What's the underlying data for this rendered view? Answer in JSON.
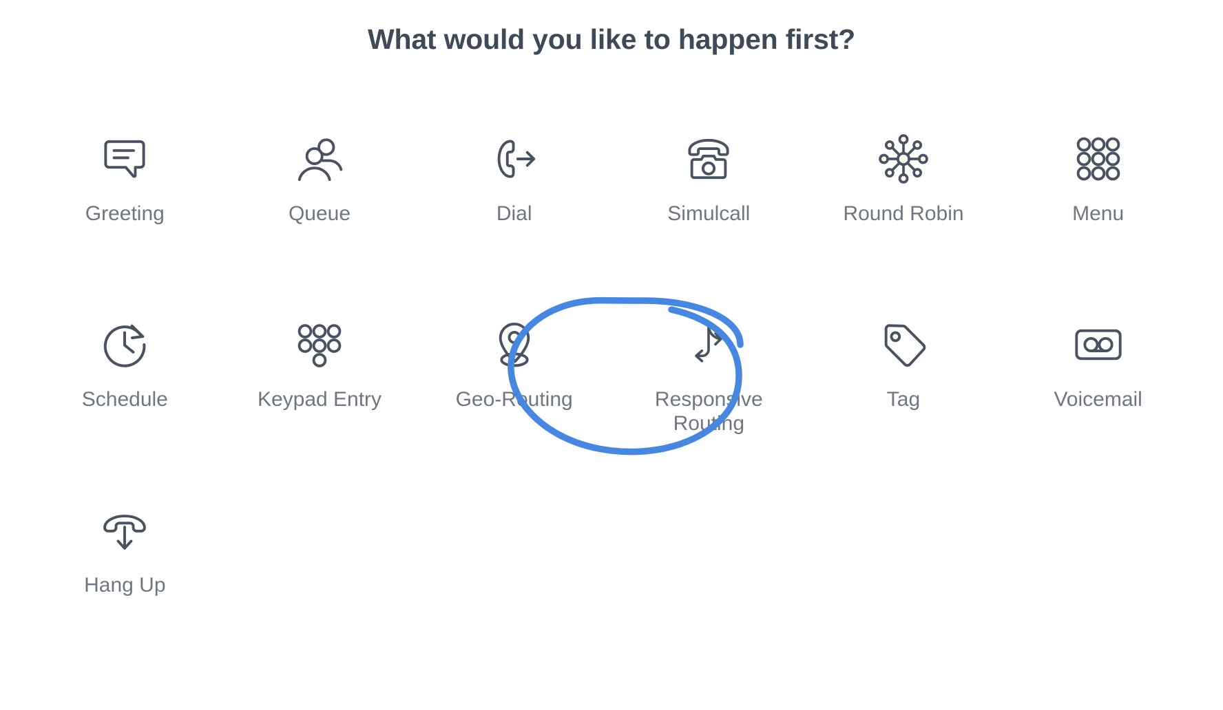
{
  "header": {
    "title": "What would you like to happen first?"
  },
  "colors": {
    "title_text": "#3f4957",
    "label_text": "#6f7680",
    "icon_stroke": "#4a5261",
    "annotation_blue": "#4787e0",
    "background": "#ffffff"
  },
  "options": [
    {
      "id": "greeting",
      "label": "Greeting",
      "icon": "speech-bubble-icon",
      "highlighted": false
    },
    {
      "id": "queue",
      "label": "Queue",
      "icon": "people-group-icon",
      "highlighted": false
    },
    {
      "id": "dial",
      "label": "Dial",
      "icon": "phone-outgoing-icon",
      "highlighted": false
    },
    {
      "id": "simulcall",
      "label": "Simulcall",
      "icon": "desk-phone-icon",
      "highlighted": false
    },
    {
      "id": "round-robin",
      "label": "Round Robin",
      "icon": "hub-spokes-icon",
      "highlighted": false
    },
    {
      "id": "menu",
      "label": "Menu",
      "icon": "grid-nine-circles-icon",
      "highlighted": false
    },
    {
      "id": "schedule",
      "label": "Schedule",
      "icon": "clock-arrow-icon",
      "highlighted": false
    },
    {
      "id": "keypad-entry",
      "label": "Keypad Entry",
      "icon": "dialpad-icon",
      "highlighted": false
    },
    {
      "id": "geo-routing",
      "label": "Geo-Routing",
      "icon": "map-pin-icon",
      "highlighted": false
    },
    {
      "id": "responsive-routing",
      "label": "Responsive Routing",
      "icon": "branching-arrows-icon",
      "highlighted": true
    },
    {
      "id": "tag",
      "label": "Tag",
      "icon": "price-tag-icon",
      "highlighted": false
    },
    {
      "id": "voicemail",
      "label": "Voicemail",
      "icon": "voicemail-tape-icon",
      "highlighted": false
    },
    {
      "id": "hang-up",
      "label": "Hang Up",
      "icon": "phone-hangup-icon",
      "highlighted": false
    }
  ],
  "annotation": {
    "type": "hand-drawn-ellipse",
    "target": "responsive-routing",
    "color": "#4787e0",
    "stroke_width": 9
  }
}
